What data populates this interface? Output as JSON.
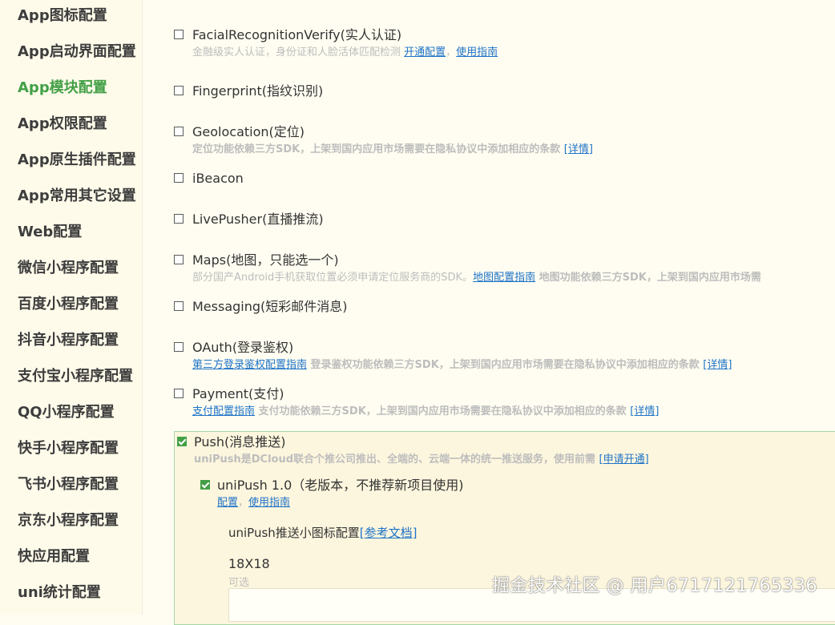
{
  "sidebar": {
    "items": [
      {
        "label": "App图标配置",
        "active": false
      },
      {
        "label": "App启动界面配置",
        "active": false
      },
      {
        "label": "App模块配置",
        "active": true
      },
      {
        "label": "App权限配置",
        "active": false
      },
      {
        "label": "App原生插件配置",
        "active": false
      },
      {
        "label": "App常用其它设置",
        "active": false
      },
      {
        "label": "Web配置",
        "active": false
      },
      {
        "label": "微信小程序配置",
        "active": false
      },
      {
        "label": "百度小程序配置",
        "active": false
      },
      {
        "label": "抖音小程序配置",
        "active": false
      },
      {
        "label": "支付宝小程序配置",
        "active": false
      },
      {
        "label": "QQ小程序配置",
        "active": false
      },
      {
        "label": "快手小程序配置",
        "active": false
      },
      {
        "label": "飞书小程序配置",
        "active": false
      },
      {
        "label": "京东小程序配置",
        "active": false
      },
      {
        "label": "快应用配置",
        "active": false
      },
      {
        "label": "uni统计配置",
        "active": false
      }
    ]
  },
  "modules": {
    "facial": {
      "title": "FacialRecognitionVerify(实人认证)",
      "desc": "金融级实人认证，身份证和人脸活体匹配检测 ",
      "link1": "开通配置",
      "sep": "，",
      "link2": "使用指南",
      "checked": false
    },
    "fingerprint": {
      "title": "Fingerprint(指纹识别)",
      "checked": false
    },
    "geolocation": {
      "title": "Geolocation(定位)",
      "desc": "定位功能依赖三方SDK，上架到国内应用市场需要在隐私协议中添加相应的条款 ",
      "link": "[详情]",
      "checked": false
    },
    "ibeacon": {
      "title": "iBeacon",
      "checked": false
    },
    "livepusher": {
      "title": "LivePusher(直播推流)",
      "checked": false
    },
    "maps": {
      "title": "Maps(地图，只能选一个)",
      "desc": "部分国产Android手机获取位置必须申请定位服务商的SDK。",
      "link": "地图配置指南",
      "desc2": " 地图功能依赖三方SDK，上架到国内应用市场需",
      "checked": false
    },
    "messaging": {
      "title": "Messaging(短彩邮件消息)",
      "checked": false
    },
    "oauth": {
      "title": "OAuth(登录鉴权)",
      "link": "第三方登录鉴权配置指南",
      "desc": " 登录鉴权功能依赖三方SDK，上架到国内应用市场需要在隐私协议中添加相应的条款 ",
      "link2": "[详情]",
      "checked": false
    },
    "payment": {
      "title": "Payment(支付)",
      "link": "支付配置指南",
      "desc": " 支付功能依赖三方SDK，上架到国内应用市场需要在隐私协议中添加相应的条款 ",
      "link2": "[详情]",
      "checked": false
    },
    "push": {
      "title": "Push(消息推送)",
      "desc": "uniPush是DCloud联合个推公司推出、全端的、云端一体的统一推送服务，使用前需 ",
      "link": "[申请开通]",
      "checked": true,
      "unipush": {
        "title": "uniPush 1.0（老版本，不推荐新项目使用)",
        "link1": "配置",
        "sep": "，",
        "link2": "使用指南",
        "checked": true,
        "icon_config_label": "uniPush推送小图标配置",
        "icon_config_link": "[参考文档]",
        "size_label": "18X18",
        "optional_label": "可选"
      }
    }
  },
  "watermark": "掘金技术社区 @ 用户6717121765336"
}
